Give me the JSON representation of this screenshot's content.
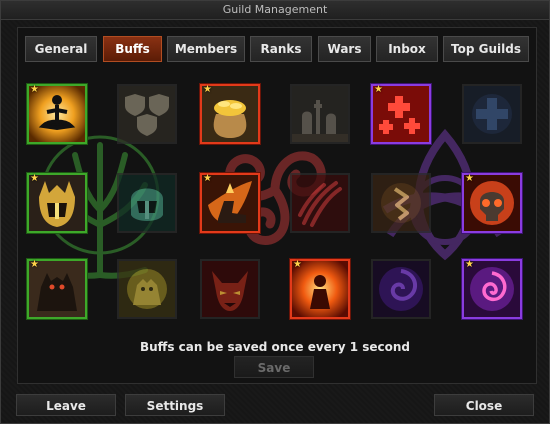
{
  "window": {
    "title": "Guild Management"
  },
  "tabs": [
    {
      "label": "General",
      "active": false
    },
    {
      "label": "Buffs",
      "active": true
    },
    {
      "label": "Members",
      "active": false
    },
    {
      "label": "Ranks",
      "active": false
    },
    {
      "label": "Wars",
      "active": false
    },
    {
      "label": "Inbox",
      "active": false
    },
    {
      "label": "Top Guilds",
      "active": false
    }
  ],
  "buffs": {
    "message": "Buffs can be saved once every 1 second",
    "save_label": "Save",
    "save_enabled": false,
    "colors": {
      "green": "#3ea82a",
      "red": "#e33a1a",
      "purple": "#8a3ce0",
      "accent": "#8a3113"
    },
    "grid": [
      [
        {
          "icon": "meditation-icon",
          "active": true,
          "starred": true
        },
        {
          "icon": "shields-icon",
          "active": false,
          "starred": false
        },
        {
          "icon": "gold-sack-icon",
          "active": true,
          "starred": true
        },
        {
          "icon": "graveyard-icon",
          "active": false,
          "starred": false
        },
        {
          "icon": "red-crosses-icon",
          "active": true,
          "starred": true
        },
        {
          "icon": "blue-cross-icon",
          "active": false,
          "starred": false
        }
      ],
      [
        {
          "icon": "golden-helmet-icon",
          "active": true,
          "starred": true
        },
        {
          "icon": "green-helmet-icon",
          "active": false,
          "starred": false
        },
        {
          "icon": "flaming-boot-icon",
          "active": true,
          "starred": true
        },
        {
          "icon": "claw-slash-icon",
          "active": false,
          "starred": false
        },
        {
          "icon": "rune-icon",
          "active": false,
          "starred": false
        },
        {
          "icon": "flaming-skull-icon",
          "active": true,
          "starred": true
        }
      ],
      [
        {
          "icon": "beast-icon",
          "active": true,
          "starred": true
        },
        {
          "icon": "golden-beast-icon",
          "active": false,
          "starred": false
        },
        {
          "icon": "demon-face-icon",
          "active": false,
          "starred": false
        },
        {
          "icon": "fire-person-icon",
          "active": true,
          "starred": true
        },
        {
          "icon": "purple-vortex-icon",
          "active": false,
          "starred": false
        },
        {
          "icon": "pink-spiral-icon",
          "active": true,
          "starred": true
        }
      ]
    ]
  },
  "footer": {
    "leave_label": "Leave",
    "settings_label": "Settings",
    "close_label": "Close"
  }
}
